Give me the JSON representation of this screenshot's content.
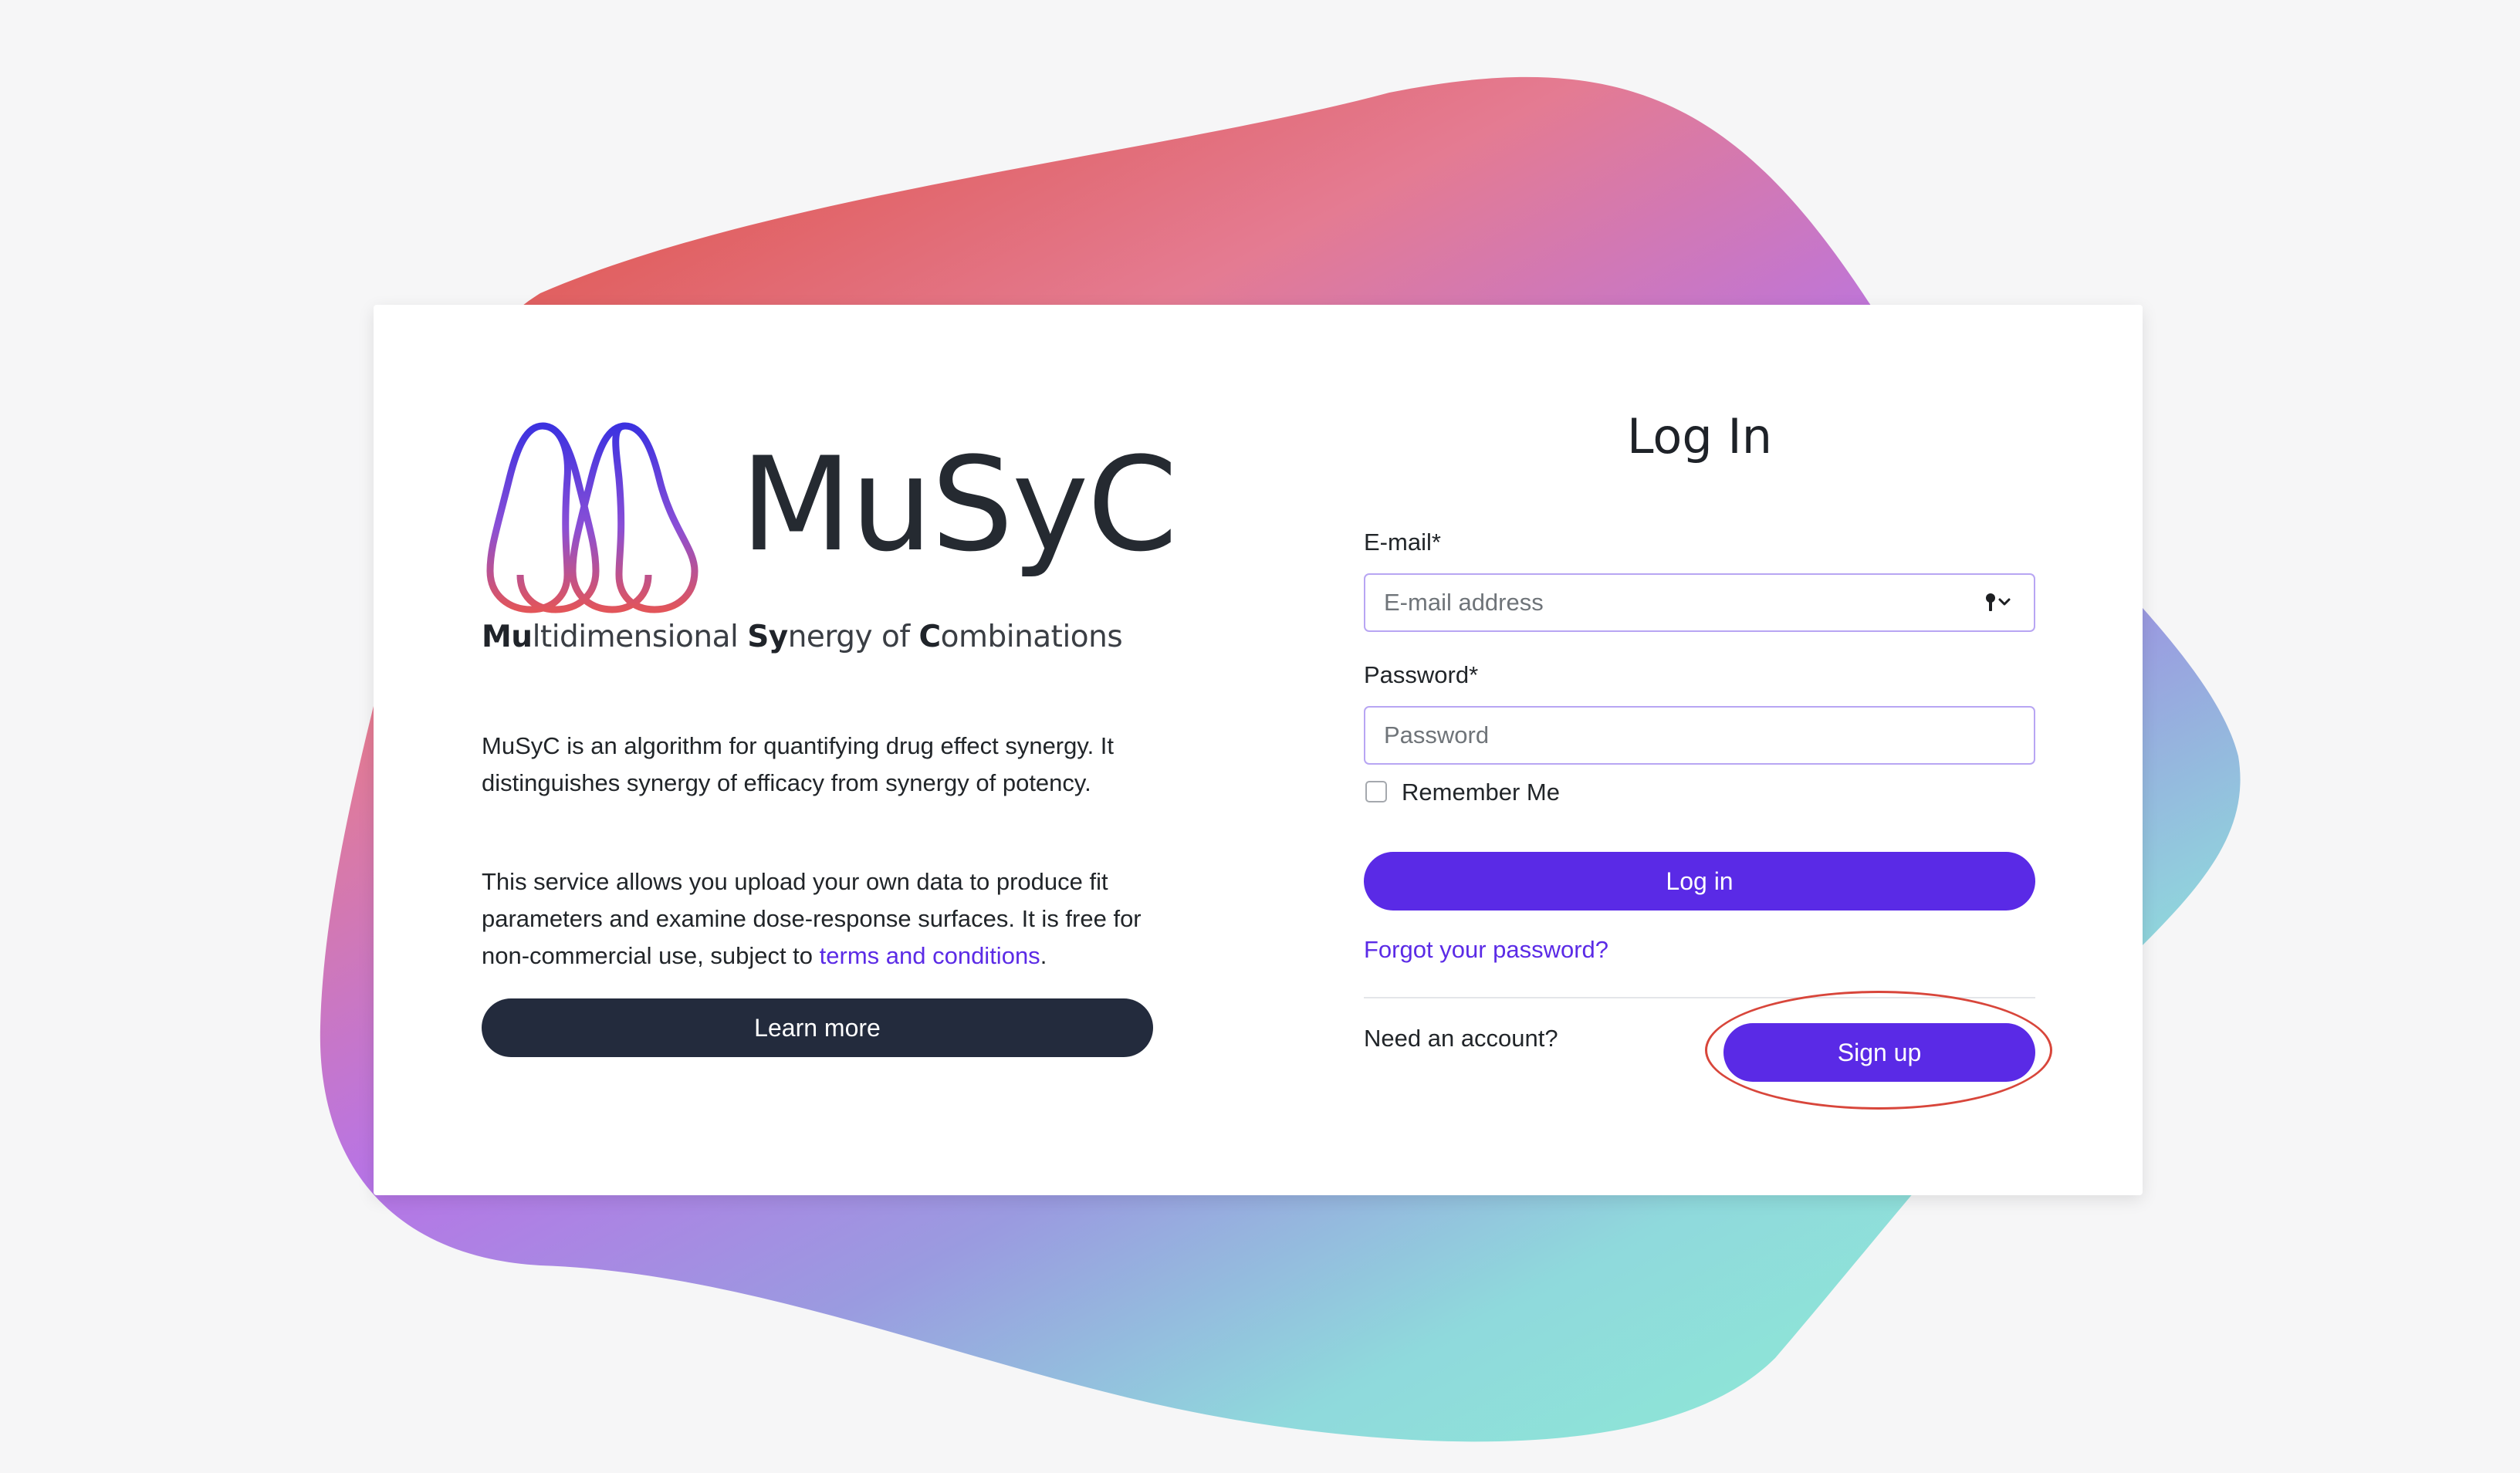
{
  "brand": {
    "name": "MuSyC",
    "tagline": {
      "p1_bold": "Mu",
      "p1_rest": "ltidimensional ",
      "p2_bold": "Sy",
      "p2_rest": "nergy of ",
      "p3_bold": "C",
      "p3_rest": "ombinations"
    }
  },
  "intro": {
    "paragraph1": "MuSyC is an algorithm for quantifying drug effect synergy. It distinguishes synergy of efficacy from synergy of potency.",
    "paragraph2_before": "This service allows you upload your own data to produce fit parameters and examine dose-response surfaces. It is free for non-commercial use, subject to ",
    "terms_link": "terms and conditions",
    "paragraph2_after": ".",
    "learn_more_label": "Learn more"
  },
  "login": {
    "title": "Log In",
    "email_label": "E-mail*",
    "email_placeholder": "E-mail address",
    "email_value": "",
    "password_label": "Password*",
    "password_placeholder": "Password",
    "password_value": "",
    "remember_label": "Remember Me",
    "remember_checked": false,
    "login_button": "Log in",
    "forgot_link": "Forgot your password?",
    "need_account": "Need an account?",
    "signup_button": "Sign up"
  },
  "icons": {
    "email_field_icon": "key-dropdown-icon"
  },
  "colors": {
    "accent": "#5a2ae6",
    "dark_button": "#232b3d",
    "link": "#5b2be6",
    "highlight": "#d8463b"
  }
}
